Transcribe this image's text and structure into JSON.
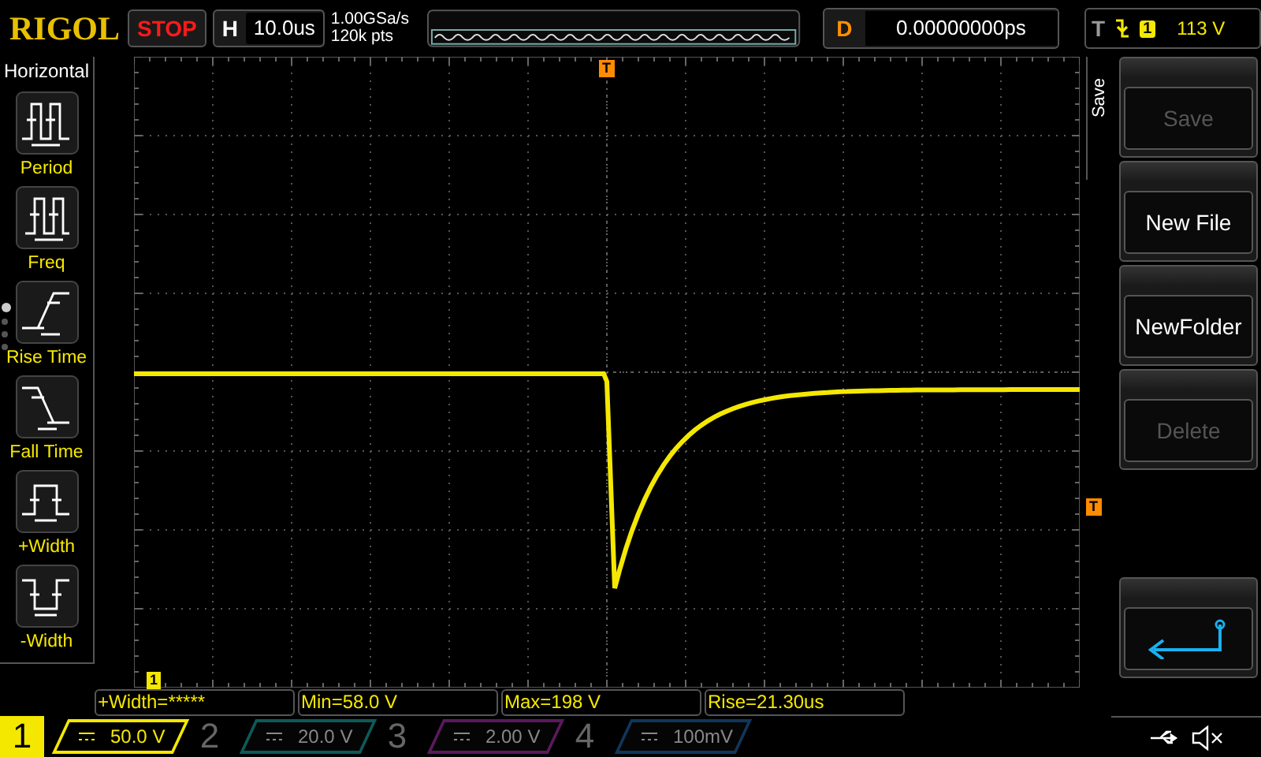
{
  "brand": "RIGOL",
  "run_state": "STOP",
  "timebase": {
    "label": "H",
    "value": "10.0us"
  },
  "acquisition": {
    "sample_rate": "1.00GSa/s",
    "memory_depth": "120k pts"
  },
  "delay": {
    "label": "D",
    "value": "0.00000000ps"
  },
  "trigger": {
    "label": "T",
    "channel": "1",
    "level": "113 V"
  },
  "markers": {
    "trigger_position": "T",
    "trigger_level": "T",
    "channel": "1"
  },
  "measure_menu": {
    "title": "Horizontal",
    "items": [
      {
        "label": "Period",
        "kind": "period"
      },
      {
        "label": "Freq",
        "kind": "freq"
      },
      {
        "label": "Rise Time",
        "kind": "rise"
      },
      {
        "label": "Fall Time",
        "kind": "fall"
      },
      {
        "label": "+Width",
        "kind": "pwidth"
      },
      {
        "label": "-Width",
        "kind": "nwidth"
      }
    ]
  },
  "page_dots": [
    {
      "selected": true
    },
    {
      "selected": false
    },
    {
      "selected": false
    },
    {
      "selected": false
    }
  ],
  "save_menu": {
    "title": "Save",
    "buttons": [
      {
        "kind": "text",
        "label": "Save",
        "disabled": true
      },
      {
        "kind": "text",
        "label": "New File",
        "disabled": false
      },
      {
        "kind": "text",
        "label": "NewFolder",
        "disabled": false
      },
      {
        "kind": "text",
        "label": "Delete",
        "disabled": true
      },
      {
        "kind": "back",
        "disabled": false
      }
    ]
  },
  "measurements": [
    "+Width=*****",
    "Min=58.0 V",
    "Max=198 V",
    "Rise=21.30us"
  ],
  "channels": [
    {
      "number": "1",
      "scale": "50.0 V",
      "on": true,
      "color": "#f5e800"
    },
    {
      "number": "2",
      "scale": "20.0 V",
      "on": false,
      "color": "#0e5a58"
    },
    {
      "number": "3",
      "scale": "2.00 V",
      "on": false,
      "color": "#5a1a5c"
    },
    {
      "number": "4",
      "scale": "100mV",
      "on": false,
      "color": "#10365a"
    }
  ]
}
